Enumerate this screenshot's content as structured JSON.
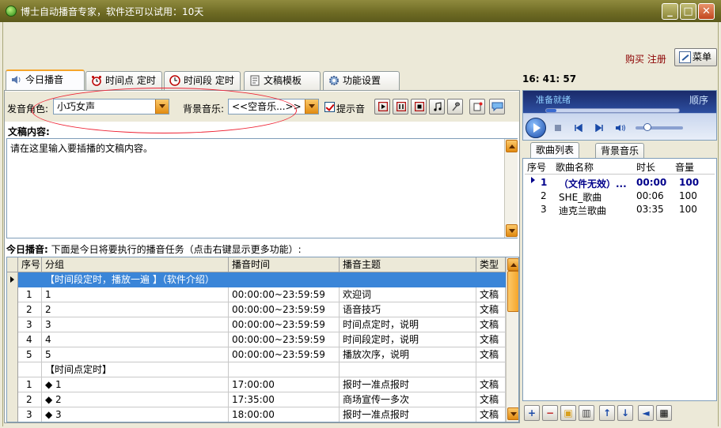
{
  "window": {
    "title": "博士自动播音专家，软件还可以试用：10天"
  },
  "header": {
    "buy_register": "购买 注册",
    "menu_label": "菜单"
  },
  "tabs": [
    {
      "label": "今日播音",
      "icon": "speaker-icon"
    },
    {
      "label": "时间点 定时",
      "icon": "alarm-clock-icon"
    },
    {
      "label": "时间段 定时",
      "icon": "clock-icon"
    },
    {
      "label": "文稿模板",
      "icon": "document-icon"
    },
    {
      "label": "功能设置",
      "icon": "gear-icon"
    }
  ],
  "clock": "16: 41: 57",
  "voice_row": {
    "voice_label": "发音角色:",
    "voice_value": "小巧女声",
    "bgm_label": "背景音乐:",
    "bgm_value": "<<空音乐...>>",
    "prompt_label": "提示音",
    "prompt_checked": true
  },
  "content": {
    "label": "文稿内容:",
    "text": "请在这里输入要插播的文稿内容。"
  },
  "today": {
    "label_bold": "今日播音:",
    "label_rest": "下面是今日将要执行的播音任务（点击右键显示更多功能）:",
    "columns": [
      "序号",
      "分组",
      "播音时间",
      "播音主题",
      "类型"
    ],
    "rows": [
      {
        "no": "",
        "group": "【时间段定时，播放一遍 】（软件介绍）",
        "time": "",
        "topic": "",
        "type": "",
        "selected": true
      },
      {
        "no": "1",
        "group": "1",
        "time": "00:00:00~23:59:59",
        "topic": "欢迎词",
        "type": "文稿"
      },
      {
        "no": "2",
        "group": "2",
        "time": "00:00:00~23:59:59",
        "topic": "语音技巧",
        "type": "文稿"
      },
      {
        "no": "3",
        "group": "3",
        "time": "00:00:00~23:59:59",
        "topic": "时间点定时，说明",
        "type": "文稿"
      },
      {
        "no": "4",
        "group": "4",
        "time": "00:00:00~23:59:59",
        "topic": "时间段定时，说明",
        "type": "文稿"
      },
      {
        "no": "5",
        "group": "5",
        "time": "00:00:00~23:59:59",
        "topic": "播放次序，说明",
        "type": "文稿"
      },
      {
        "no": "",
        "group": "【时间点定时】",
        "time": "",
        "topic": "",
        "type": ""
      },
      {
        "no": "1",
        "group": "◆ 1",
        "time": "17:00:00",
        "topic": "报时一准点报时",
        "type": "文稿"
      },
      {
        "no": "2",
        "group": "◆ 2",
        "time": "17:35:00",
        "topic": "商场宣传一多次",
        "type": "文稿"
      },
      {
        "no": "3",
        "group": "◆ 3",
        "time": "18:00:00",
        "topic": "报时一准点报时",
        "type": "文稿"
      }
    ]
  },
  "player": {
    "status": "准备就绪",
    "mode": "顺序",
    "progress_fraction": 0.08,
    "volume_fraction": 0.25
  },
  "right_tabs": [
    "歌曲列表",
    "背景音乐"
  ],
  "songs": {
    "columns": [
      "序号",
      "歌曲名称",
      "时长",
      "音量"
    ],
    "rows": [
      {
        "no": "1",
        "name": "（文件无效）...",
        "duration": "00:00",
        "volume": "100",
        "current": true
      },
      {
        "no": "2",
        "name": "SHE_歌曲",
        "duration": "00:06",
        "volume": "100"
      },
      {
        "no": "3",
        "name": "迪克兰歌曲",
        "duration": "03:35",
        "volume": "100"
      }
    ]
  }
}
